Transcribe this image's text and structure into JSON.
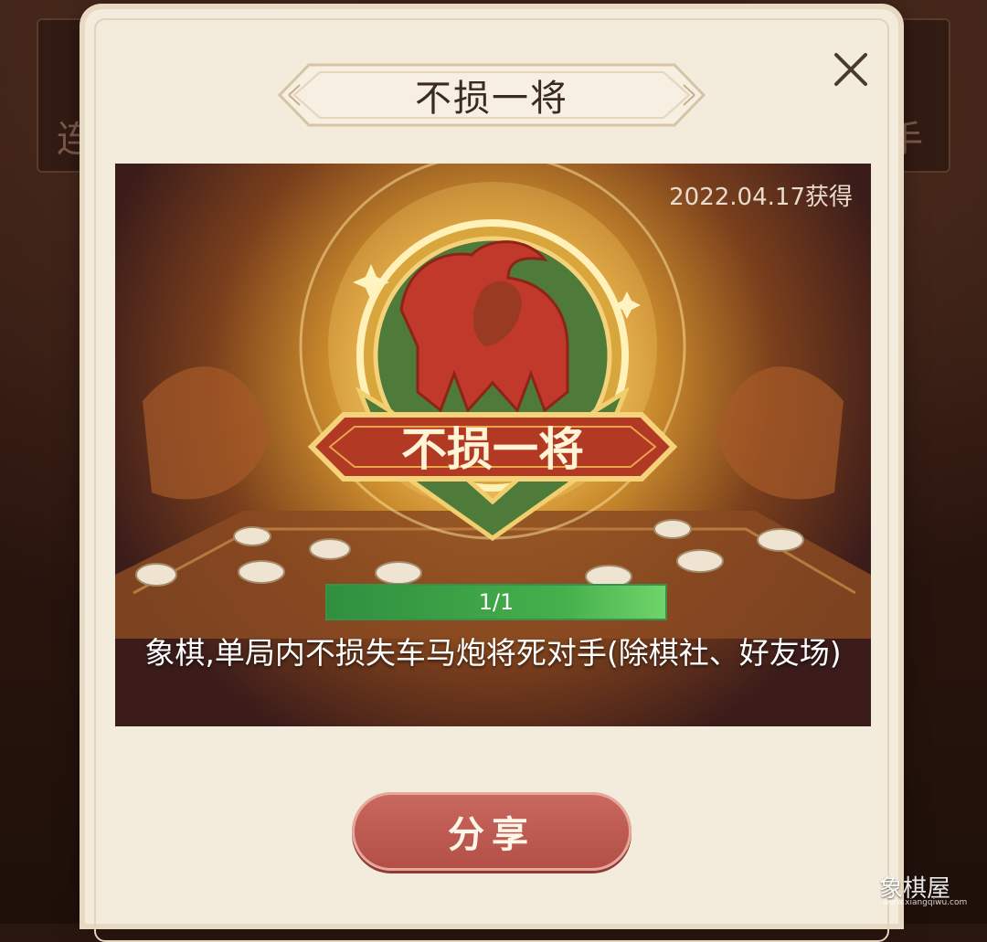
{
  "background": {
    "left_char": "连",
    "right_char": "手"
  },
  "dialog": {
    "title": "不损一将",
    "close_icon": "close-icon"
  },
  "achievement": {
    "date_text": "2022.04.17获得",
    "badge_label": "不损一将",
    "progress_text": "1/1",
    "progress_fraction": 1.0,
    "description": "象棋,单局内不损失车马炮将死对手(除棋社、好友场)"
  },
  "share_button": {
    "label": "分享"
  },
  "watermark": {
    "text": "象棋屋",
    "sub": "www.xiangqiwu.com"
  },
  "colors": {
    "modal_bg": "#f3ebdc",
    "share_button": "#b8554c",
    "progress_green": "#45b04c",
    "badge_red": "#c0392b",
    "badge_green": "#4e7a3a"
  }
}
